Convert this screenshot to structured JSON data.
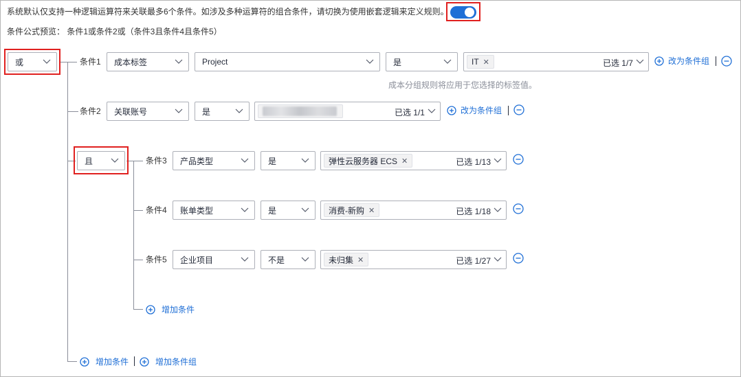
{
  "notice": "系统默认仅支持一种逻辑运算符来关联最多6个条件。如涉及多种运算符的组合条件，请切换为使用嵌套逻辑来定义规则。",
  "nested_toggle": {
    "on": true
  },
  "preview": "条件公式预览：  条件1或条件2或（条件3且条件4且条件5）",
  "root_operator": "或",
  "group_operator": "且",
  "conditions": [
    {
      "label": "条件1",
      "field": "成本标签",
      "key": "Project",
      "op": "是",
      "tags": [
        "IT"
      ],
      "count": "已选 1/7",
      "hint": "成本分组规则将应用于您选择的标签值。",
      "to_group": "改为条件组"
    },
    {
      "label": "条件2",
      "field": "关联账号",
      "op": "是",
      "tags": [],
      "count": "已选 1/1",
      "to_group": "改为条件组"
    },
    {
      "label": "条件3",
      "field": "产品类型",
      "op": "是",
      "tags": [
        "弹性云服务器 ECS"
      ],
      "count": "已选 1/13"
    },
    {
      "label": "条件4",
      "field": "账单类型",
      "op": "是",
      "tags": [
        "消费-新购"
      ],
      "count": "已选 1/18"
    },
    {
      "label": "条件5",
      "field": "企业项目",
      "op": "不是",
      "tags": [
        "未归集"
      ],
      "count": "已选 1/27"
    }
  ],
  "actions": {
    "add_condition": "增加条件",
    "add_condition_group": "增加条件组",
    "group_add_condition": "增加条件"
  },
  "colors": {
    "accent": "#1f6fd6",
    "highlight": "#e0201f",
    "border": "#adb0b8"
  },
  "icons": {
    "chevron": "chevron-down-icon",
    "remove": "minus-circle-icon",
    "add": "plus-circle-icon",
    "tag_close": "close-icon"
  }
}
